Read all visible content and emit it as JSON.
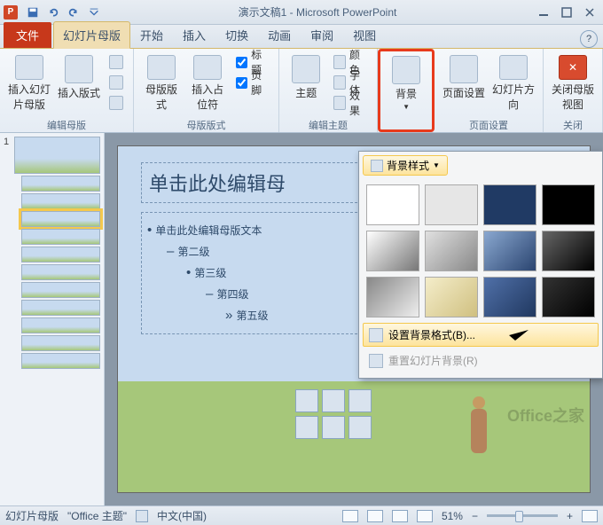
{
  "title": "演示文稿1 - Microsoft PowerPoint",
  "app_letter": "P",
  "tabs": {
    "file": "文件",
    "master": "幻灯片母版",
    "home": "开始",
    "insert": "插入",
    "transition": "切换",
    "animation": "动画",
    "review": "审阅",
    "view": "视图"
  },
  "ribbon": {
    "group1": {
      "label": "编辑母版",
      "btn1": "插入幻灯片母版",
      "btn2": "插入版式"
    },
    "group2": {
      "label": "母版版式",
      "btn1": "母版版式",
      "btn2": "插入占位符",
      "chk1": "标题",
      "chk2": "页脚"
    },
    "group3": {
      "label": "编辑主题",
      "btn1": "主题",
      "row1": "颜色",
      "row2": "字体",
      "row3": "效果"
    },
    "bg_btn": "背景",
    "group4": {
      "label": "页面设置",
      "btn1": "页面设置",
      "btn2": "幻灯片方向"
    },
    "group5": {
      "label": "关闭",
      "btn1": "关闭母版视图"
    }
  },
  "slide": {
    "title": "单击此处编辑母",
    "l1": "单击此处编辑母版文本",
    "l2": "第二级",
    "l3": "第三级",
    "l4": "第四级",
    "l5": "第五级"
  },
  "watermark": "Office之家",
  "popup": {
    "header_btn": "背景样式",
    "item1": "设置背景格式(B)...",
    "item2": "重置幻灯片背景(R)"
  },
  "swatches": [
    "#ffffff",
    "#e6e6e6",
    "#203a64",
    "#000000",
    "linear-gradient(135deg,#fff,#777)",
    "linear-gradient(135deg,#e0e0e0,#888)",
    "linear-gradient(135deg,#8aa8d0,#2a4470)",
    "linear-gradient(135deg,#666,#000)",
    "linear-gradient(135deg,#888,#eee)",
    "linear-gradient(135deg,#f4edca,#d0c080)",
    "linear-gradient(135deg,#5070a8,#203860)",
    "linear-gradient(135deg,#333,#000)"
  ],
  "status": {
    "view": "幻灯片母版",
    "theme": "\"Office 主题\"",
    "lang": "中文(中国)",
    "zoom": "51%"
  },
  "icons": {
    "save": "save-icon",
    "undo": "undo-icon",
    "redo": "redo-icon",
    "dropdown": "chevron-down-icon",
    "minimize": "minimize-icon",
    "maximize": "maximize-icon",
    "close": "close-icon"
  }
}
